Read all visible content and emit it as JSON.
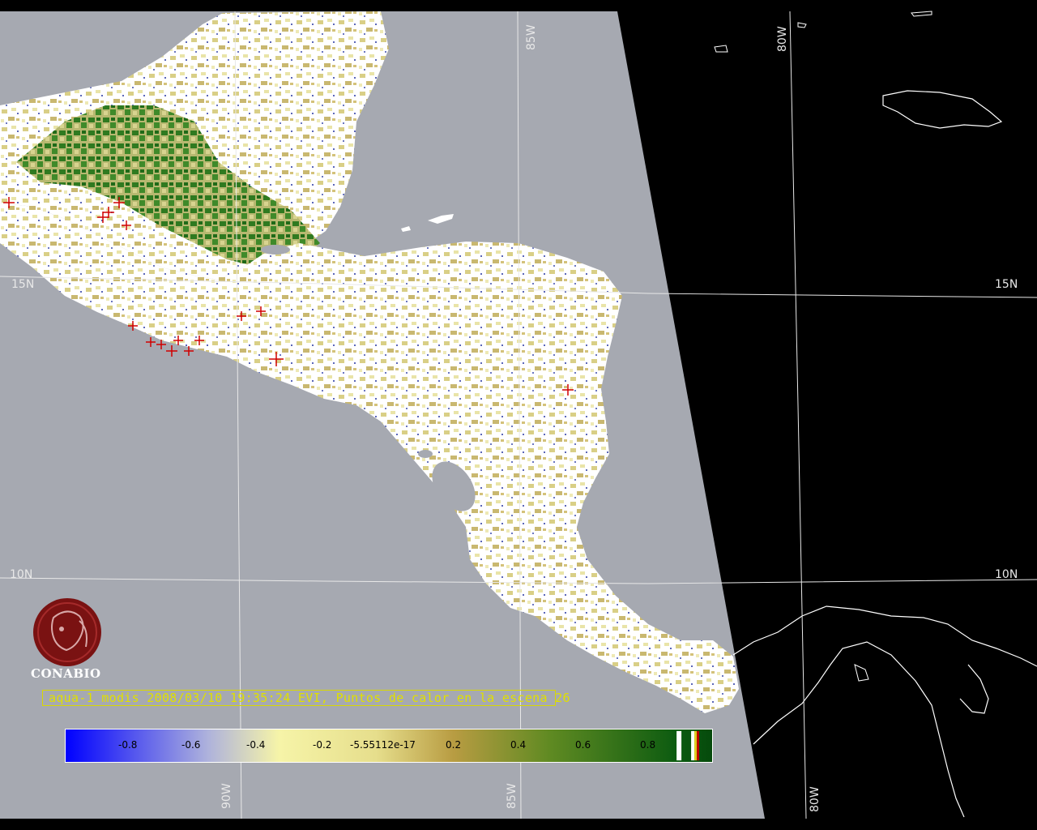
{
  "grid": {
    "lon_labels_top": [
      "85W",
      "80W"
    ],
    "lon_labels_bottom": [
      "90W",
      "85W",
      "80W"
    ],
    "lat_labels_left": [
      "15N",
      "10N"
    ],
    "lat_labels_right": [
      "15N",
      "10N"
    ]
  },
  "logo": {
    "text": "CONABIO"
  },
  "caption": {
    "text": "aqua-1 modis 2008/03/10 19:35:24 EVI, Puntos de calor en la escena 26"
  },
  "colorbar": {
    "ticks": [
      "-0.8",
      "-0.6",
      "-0.4",
      "-0.2",
      "-5.55112e-17",
      "0.2",
      "0.4",
      "0.6",
      "0.8"
    ],
    "colors": {
      "low": "#0000ff",
      "mid_low": "#b0b8d8",
      "zero": "#f4f2a0",
      "mid_high": "#b89c40",
      "high": "#0a6a10"
    }
  },
  "colors": {
    "ocean": "#a6a9b1",
    "land_cloud": "#ffffff",
    "fire_marker": "#d00000",
    "outside_scene": "#000000"
  }
}
